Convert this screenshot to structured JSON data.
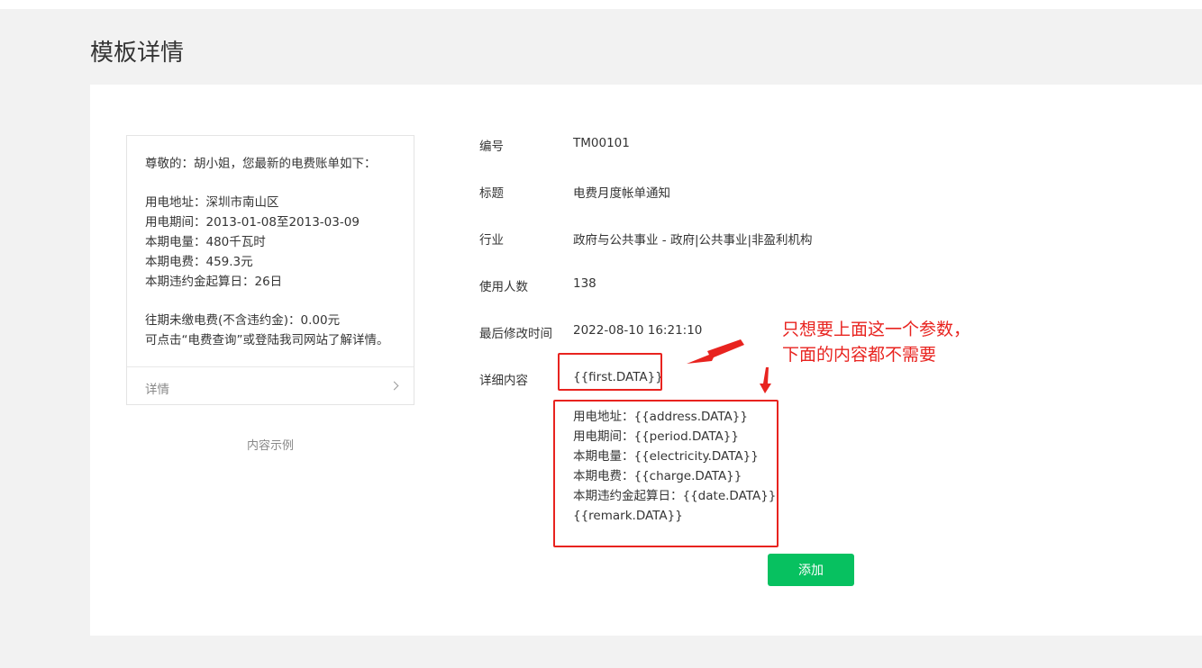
{
  "page": {
    "title": "模板详情"
  },
  "preview": {
    "greeting": "尊敬的：胡小姐，您最新的电费账单如下：",
    "lines": [
      "用电地址：深圳市南山区",
      "用电期间：2013-01-08至2013-03-09",
      "本期电量：480千瓦时",
      "本期电费：459.3元",
      "本期违约金起算日：26日"
    ],
    "footer_lines": [
      "往期未缴电费(不含违约金)：0.00元",
      "可点击“电费查询”或登陆我司网站了解详情。"
    ],
    "detail_label": "详情",
    "caption": "内容示例"
  },
  "info": {
    "code": {
      "label": "编号",
      "value": "TM00101"
    },
    "title": {
      "label": "标题",
      "value": "电费月度帐单通知"
    },
    "industry": {
      "label": "行业",
      "value": "政府与公共事业 - 政府|公共事业|非盈利机构"
    },
    "users": {
      "label": "使用人数",
      "value": "138"
    },
    "modified": {
      "label": "最后修改时间",
      "value": "2022-08-10 16:21:10"
    },
    "content": {
      "label": "详细内容",
      "first": "{{first.DATA}}",
      "lines": [
        "用电地址：{{address.DATA}}",
        "用电期间：{{period.DATA}}",
        "本期电量：{{electricity.DATA}}",
        "本期电费：{{charge.DATA}}",
        "本期违约金起算日：{{date.DATA}}",
        "{{remark.DATA}}"
      ]
    }
  },
  "actions": {
    "add_label": "添加"
  },
  "annotation": {
    "line1": "只想要上面这一个参数，",
    "line2": "下面的内容都不需要"
  },
  "colors": {
    "accent": "#07c160",
    "annotation": "#e8231f",
    "background": "#f2f2f2"
  }
}
